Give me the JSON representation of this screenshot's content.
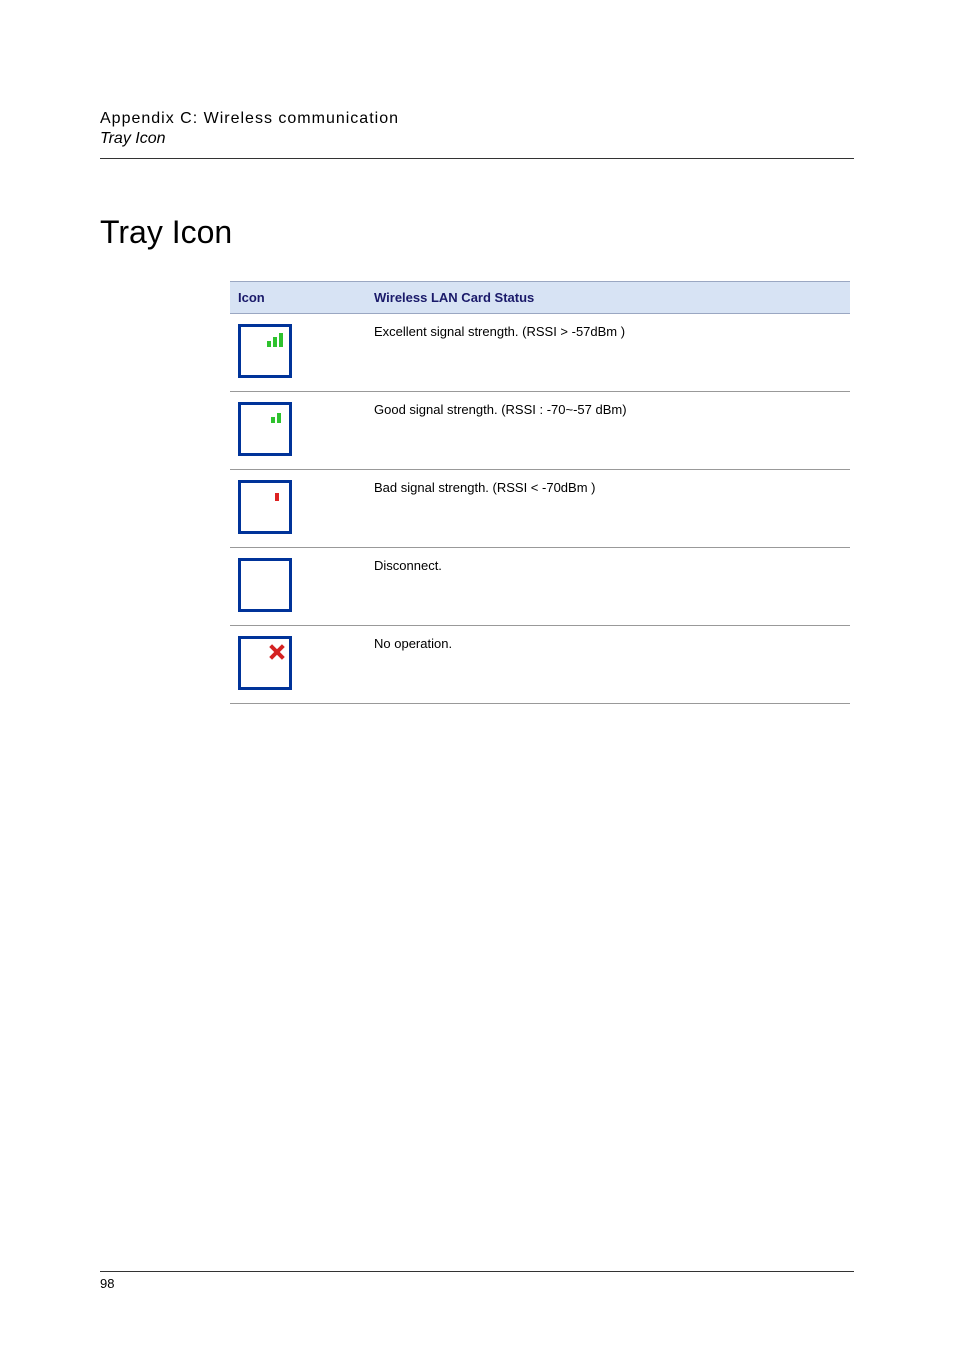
{
  "header": {
    "appendix_line": "Appendix C: Wireless communication",
    "subline": "Tray Icon"
  },
  "section": {
    "title": "Tray Icon"
  },
  "table": {
    "col_icon": "Icon",
    "col_status": "Wireless LAN Card Status",
    "rows": [
      {
        "icon_name": "signal-excellent-icon",
        "status": "Excellent signal strength. (RSSI > -57dBm )"
      },
      {
        "icon_name": "signal-good-icon",
        "status": "Good signal strength. (RSSI : -70~-57 dBm)"
      },
      {
        "icon_name": "signal-bad-icon",
        "status": "Bad signal strength. (RSSI < -70dBm )"
      },
      {
        "icon_name": "signal-disconnect-icon",
        "status": "Disconnect."
      },
      {
        "icon_name": "signal-nooperation-icon",
        "status": "No operation."
      }
    ]
  },
  "footer": {
    "page_number": "98"
  }
}
